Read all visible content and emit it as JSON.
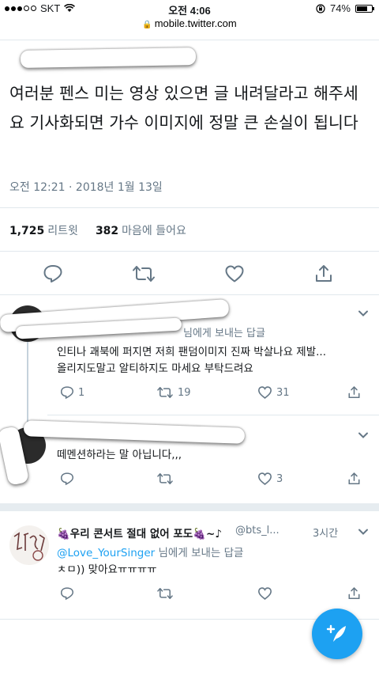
{
  "status": {
    "carrier": "SKT",
    "time": "오전 4:06",
    "battery": "74%",
    "battery_fraction": 0.74
  },
  "url": "mobile.twitter.com",
  "tweet": {
    "text": "여러분 펜스 미는 영상 있으면 글 내려달라고 해주세요 기사화되면 가수 이미지에 정말 큰 손실이 됩니다",
    "date": "오전 12:21 · 2018년 1월 13일",
    "retweets_count": "1,725",
    "retweets_label": "리트윗",
    "likes_count": "382",
    "likes_label": "마음에 들어요"
  },
  "replies": [
    {
      "replying_to": "님에게 보내는 답글",
      "text": "인티나 괘북에 퍼지면 저희 팬덤이미지 진짜 박살나요 제발...\n올리지도말고 알티하지도 마세요 부탁드려요",
      "reply_count": "1",
      "retweet_count": "19",
      "like_count": "31"
    },
    {
      "text": "떼멘션하라는 말 아닙니다,,,",
      "reply_count": "",
      "retweet_count": "",
      "like_count": "3"
    },
    {
      "name": "🍇우리 콘서트 절대 없어 포도🍇~♪",
      "handle": "@bts_l...",
      "time": "3시간",
      "mention": "@Love_YourSinger",
      "replying_to": "님에게 보내는 답글",
      "text": "ㅊㅁ)) 맞아요ㅠㅠㅠㅠ"
    }
  ],
  "icons": {
    "reply": "reply-icon",
    "retweet": "retweet-icon",
    "like": "heart-icon",
    "share": "share-icon",
    "more": "chevron-down-icon",
    "compose": "compose-icon"
  },
  "colors": {
    "accent": "#1da1f2",
    "meta": "#657786",
    "text": "#14171a"
  }
}
